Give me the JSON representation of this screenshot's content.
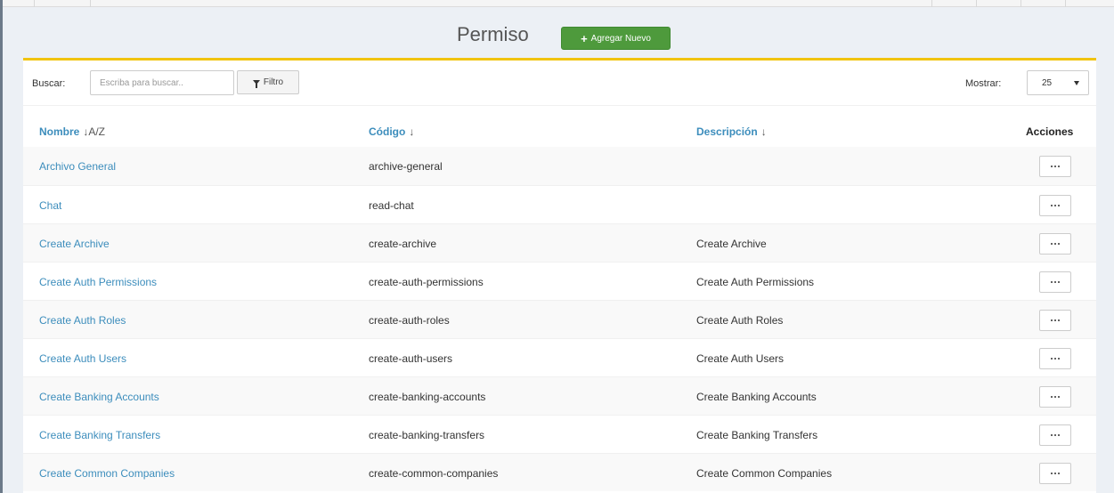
{
  "page": {
    "title": "Permiso",
    "add_button": "Agregar Nuevo"
  },
  "toolbar": {
    "search_label": "Buscar:",
    "search_placeholder": "Escriba para buscar..",
    "filter_label": "Filtro",
    "show_label": "Mostrar:",
    "show_value": "25"
  },
  "columns": {
    "name": "Nombre",
    "name_sort": "↓A/Z",
    "code": "Código",
    "code_sort": "↓",
    "description": "Descripción",
    "description_sort": "↓",
    "actions": "Acciones"
  },
  "rows": [
    {
      "name": "Archivo General",
      "code": "archive-general",
      "description": ""
    },
    {
      "name": "Chat",
      "code": "read-chat",
      "description": ""
    },
    {
      "name": "Create Archive",
      "code": "create-archive",
      "description": "Create Archive"
    },
    {
      "name": "Create Auth Permissions",
      "code": "create-auth-permissions",
      "description": "Create Auth Permissions"
    },
    {
      "name": "Create Auth Roles",
      "code": "create-auth-roles",
      "description": "Create Auth Roles"
    },
    {
      "name": "Create Auth Users",
      "code": "create-auth-users",
      "description": "Create Auth Users"
    },
    {
      "name": "Create Banking Accounts",
      "code": "create-banking-accounts",
      "description": "Create Banking Accounts"
    },
    {
      "name": "Create Banking Transfers",
      "code": "create-banking-transfers",
      "description": "Create Banking Transfers"
    },
    {
      "name": "Create Common Companies",
      "code": "create-common-companies",
      "description": "Create Common Companies"
    }
  ],
  "icons": {
    "add": "plus-icon",
    "filter": "filter-icon",
    "select": "chevron-down-icon",
    "row_menu": "ellipsis-icon"
  },
  "colors": {
    "accent_green": "#4e9a3c",
    "link_blue": "#3c8dbc",
    "box_border_yellow": "#f1c40f"
  }
}
